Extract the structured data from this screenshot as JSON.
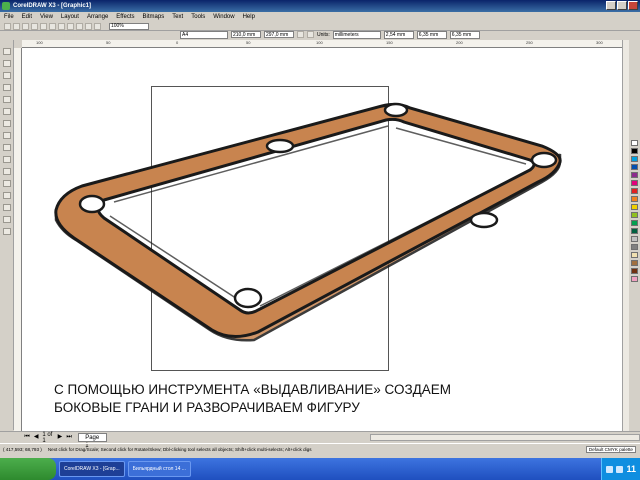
{
  "window": {
    "title": "CorelDRAW X3 - [Graphic1]"
  },
  "menu": [
    "File",
    "Edit",
    "View",
    "Layout",
    "Arrange",
    "Effects",
    "Bitmaps",
    "Text",
    "Tools",
    "Window",
    "Help"
  ],
  "toolbar": {
    "zoom": "100%"
  },
  "property_bar": {
    "paper": "A4",
    "width": "210,0 mm",
    "height": "297,0 mm",
    "units_label": "Units:",
    "units": "millimeters",
    "nudge": "2,54 mm",
    "dup_x": "6,35 mm",
    "dup_y": "6,35 mm"
  },
  "ruler_top": [
    "100",
    "50",
    "0",
    "50",
    "100",
    "150",
    "200",
    "250",
    "300"
  ],
  "canvas": {
    "caption_line1": "С ПОМОЩЬЮ ИНСТРУМЕНТА «ВЫДАВЛИВАНИЕ» СОЗДАЕМ",
    "caption_line2": "БОКОВЫЕ ГРАНИ И РАЗВОРАЧИВАЕМ ФИГУРУ",
    "table_color": "#c8844f",
    "outline_color": "#1a1a1a"
  },
  "page_nav": {
    "page_count": "1 of 1",
    "page_tab": "Page 1"
  },
  "status": {
    "coords": "( 417,593; 68,793 )",
    "tip": "Next click for Drag/Scale; Second click for Rotate/Skew; Dbl-clicking tool selects all objects; Shift+click multi-selects; Alt+click digs",
    "palette": "Default CMYK palette"
  },
  "taskbar": {
    "items": [
      "CorelDRAW X3 - [Grap...",
      "Бильярдный стол 14 ..."
    ],
    "clock": "11"
  },
  "palette_colors": [
    "#ffffff",
    "#000000",
    "#00a0e0",
    "#0050b0",
    "#8c2a8c",
    "#e0007a",
    "#e02020",
    "#f08020",
    "#f0d000",
    "#90c020",
    "#00a050",
    "#006040",
    "#c0c0c0",
    "#808080",
    "#f0e0b0",
    "#a07040",
    "#703010",
    "#f0a0c0"
  ]
}
